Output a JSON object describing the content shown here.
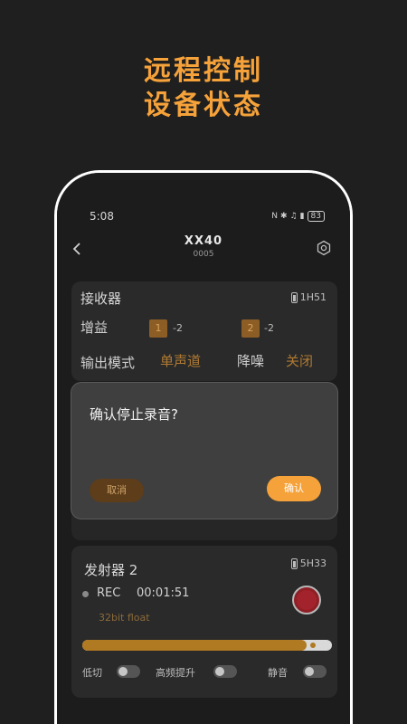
{
  "promo": {
    "line1": "远程控制",
    "line2": "设备状态"
  },
  "status_bar": {
    "time": "5:08",
    "battery": "83"
  },
  "header": {
    "device_name": "XX40",
    "device_code": "0005"
  },
  "receiver": {
    "title": "接收器",
    "battery": "1H51",
    "gain_label": "增益",
    "gains": [
      {
        "channel": "1",
        "value": "-2"
      },
      {
        "channel": "2",
        "value": "-2"
      }
    ],
    "output_mode_label": "输出模式",
    "output_mode_value": "单声道",
    "noise_reduction_label": "降噪",
    "noise_reduction_value": "关闭"
  },
  "dialog": {
    "message": "确认停止录音?",
    "cancel_label": "取消",
    "confirm_label": "确认"
  },
  "transmitter2": {
    "title": "发射器 2",
    "battery": "5H33",
    "rec_label": "REC",
    "rec_time": "00:01:51",
    "format": "32bit float",
    "level_fraction": 0.9,
    "toggles": [
      {
        "label": "低切",
        "on": false
      },
      {
        "label": "高频提升",
        "on": false
      },
      {
        "label": "静音",
        "on": false
      }
    ]
  },
  "colors": {
    "accent": "#f6a23a",
    "record": "#a3232c",
    "background": "#1f1f1f"
  },
  "icons": {
    "back": "chevron-left-icon",
    "settings": "gear-icon",
    "battery": "battery-icon"
  }
}
